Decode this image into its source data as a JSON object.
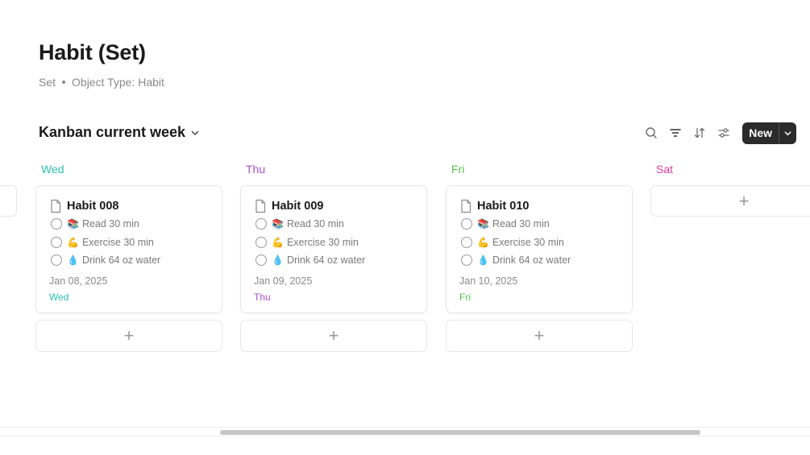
{
  "page": {
    "title": "Habit (Set)",
    "meta_type": "Set",
    "meta_object": "Object Type: Habit"
  },
  "view": {
    "title": "Kanban current week"
  },
  "toolbar": {
    "new_label": "New",
    "icons": [
      "search-icon",
      "filter-icon",
      "sort-icon",
      "settings-sliders-icon",
      "chevron-down-icon"
    ]
  },
  "colors": {
    "wed": "#2bc2b1",
    "thu": "#b04ecf",
    "fri": "#55c44a",
    "sat": "#e040a0",
    "new_button": "#2b2b2b"
  },
  "columns": [
    {
      "label": "Wed",
      "card": {
        "title": "Habit 008",
        "todos": [
          {
            "emoji": "📚",
            "text": "Read 30 min"
          },
          {
            "emoji": "💪",
            "text": "Exercise 30 min"
          },
          {
            "emoji": "💧",
            "text": "Drink 64 oz water"
          }
        ],
        "date": "Jan 08, 2025",
        "tag": "Wed"
      }
    },
    {
      "label": "Thu",
      "card": {
        "title": "Habit 009",
        "todos": [
          {
            "emoji": "📚",
            "text": "Read 30 min"
          },
          {
            "emoji": "💪",
            "text": "Exercise 30 min"
          },
          {
            "emoji": "💧",
            "text": "Drink 64 oz water"
          }
        ],
        "date": "Jan 09, 2025",
        "tag": "Thu"
      }
    },
    {
      "label": "Fri",
      "card": {
        "title": "Habit 010",
        "todos": [
          {
            "emoji": "📚",
            "text": "Read 30 min"
          },
          {
            "emoji": "💪",
            "text": "Exercise 30 min"
          },
          {
            "emoji": "💧",
            "text": "Drink 64 oz water"
          }
        ],
        "date": "Jan 10, 2025",
        "tag": "Fri"
      }
    },
    {
      "label": "Sat"
    }
  ],
  "add_symbol": "+"
}
